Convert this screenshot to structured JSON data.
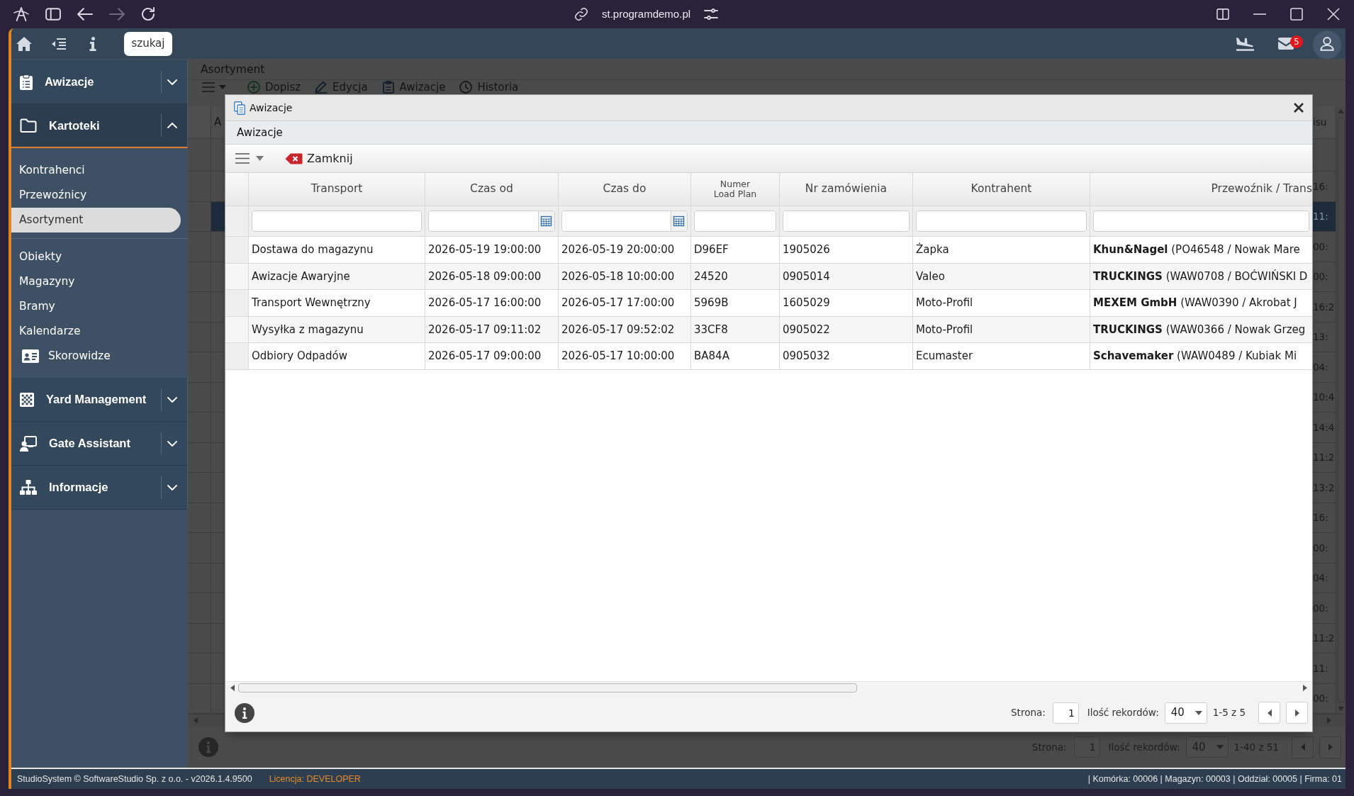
{
  "browser": {
    "url": "st.programdemo.pl"
  },
  "app_header": {
    "search_button": "szukaj",
    "mail_badge": "5"
  },
  "sidebar": {
    "sections": [
      {
        "label": "Awizacje",
        "expanded": false
      },
      {
        "label": "Kartoteki",
        "expanded": true,
        "groups": [
          [
            {
              "label": "Kontrahenci",
              "kind": "text",
              "selected": false
            },
            {
              "label": "Przewoźnicy",
              "kind": "text",
              "selected": false
            },
            {
              "label": "Asortyment",
              "kind": "text",
              "selected": true
            }
          ],
          [
            {
              "label": "Obiekty",
              "kind": "text",
              "selected": false
            },
            {
              "label": "Magazyny",
              "kind": "text",
              "selected": false
            },
            {
              "label": "Bramy",
              "kind": "text",
              "selected": false
            },
            {
              "label": "Kalendarze",
              "kind": "text",
              "selected": false
            },
            {
              "label": "Skorowidze",
              "kind": "icon",
              "selected": false
            }
          ]
        ]
      },
      {
        "label": "Yard Management",
        "expanded": false
      },
      {
        "label": "Gate Assistant",
        "expanded": false
      },
      {
        "label": "Informacje",
        "expanded": false
      }
    ]
  },
  "page": {
    "title": "Asortyment",
    "toolbar": [
      "Dopisz",
      "Edycja",
      "Awizacje",
      "Historia"
    ],
    "grid": {
      "left_header": "A",
      "right_header": "isu",
      "rows": [
        {
          "fragment": "16:",
          "selected": false
        },
        {
          "fragment": "11:",
          "selected": true
        },
        {
          "fragment": "00:",
          "selected": false
        },
        {
          "fragment": "00:",
          "selected": false
        },
        {
          "fragment": "16:2",
          "selected": false
        },
        {
          "fragment": "13:",
          "selected": false
        },
        {
          "fragment": "04:",
          "selected": false
        },
        {
          "fragment": "10:4",
          "selected": false
        },
        {
          "fragment": "14:4",
          "selected": false
        },
        {
          "fragment": "11:2",
          "selected": false
        },
        {
          "fragment": "13:2",
          "selected": false
        },
        {
          "fragment": "16:",
          "selected": false
        },
        {
          "fragment": "00:",
          "selected": false
        },
        {
          "fragment": "04:",
          "selected": false
        },
        {
          "fragment": "00:",
          "selected": false
        },
        {
          "fragment": "11:2",
          "selected": false
        },
        {
          "fragment": "11:",
          "selected": false
        },
        {
          "fragment": "00:",
          "selected": false
        }
      ]
    },
    "pager": {
      "page_label": "Strona:",
      "page": "1",
      "size_label": "Ilość rekordów:",
      "size": "40",
      "range": "1-40 z 51"
    }
  },
  "dialog": {
    "title": "Awizacje",
    "subtitle": "Awizacje",
    "close_button": "Zamknij",
    "columns": [
      {
        "label": "Transport",
        "kind": "text",
        "small": false
      },
      {
        "label": "Czas od",
        "kind": "date",
        "small": false
      },
      {
        "label": "Czas do",
        "kind": "date",
        "small": false
      },
      {
        "label": "Numer Load Plan",
        "kind": "text",
        "small": true
      },
      {
        "label": "Nr zamówienia",
        "kind": "text",
        "small": false
      },
      {
        "label": "Kontrahent",
        "kind": "text",
        "small": false
      },
      {
        "label": "Przewoźnik / Trans",
        "kind": "text",
        "small": false
      }
    ],
    "rows": [
      [
        "Dostawa do magazynu",
        "2026-05-19 19:00:00",
        "2026-05-19 20:00:00",
        "D96EF",
        "1905026",
        "Żapka",
        "**Khun&Nagel** (PO46548 / Nowak Mare"
      ],
      [
        "Awizacje Awaryjne",
        "2026-05-18 09:00:00",
        "2026-05-18 10:00:00",
        "24520",
        "0905014",
        "Valeo",
        "**TRUCKINGS** (WAW0708 / BOĆWIŃSKI D"
      ],
      [
        "Transport Wewnętrzny",
        "2026-05-17 16:00:00",
        "2026-05-17 17:00:00",
        "5969B",
        "1605029",
        "Moto-Profil",
        "**MEXEM GmbH** (WAW0390 / Akrobat J"
      ],
      [
        "Wysyłka z magazynu",
        "2026-05-17 09:11:02",
        "2026-05-17 09:52:02",
        "33CF8",
        "0905022",
        "Moto-Profil",
        "**TRUCKINGS** (WAW0366 / Nowak Grzeg"
      ],
      [
        "Odbiory Odpadów",
        "2026-05-17 09:00:00",
        "2026-05-17 10:00:00",
        "BA84A",
        "0905032",
        "Ecumaster",
        "**Schavemaker** (WAW0489 / Kubiak Mi"
      ]
    ],
    "pager": {
      "page_label": "Strona:",
      "page": "1",
      "size_label": "Ilość rekordów:",
      "size": "40",
      "range": "1-5 z 5"
    }
  },
  "footer": {
    "copyright": "StudioSystem © SoftwareStudio Sp. z o.o. - v2026.1.4.9500",
    "license": "Licencja: DEVELOPER",
    "context": "| Komórka: 00006 | Magazyn: 00003 | Oddział: 00005 | Firma: 01"
  }
}
